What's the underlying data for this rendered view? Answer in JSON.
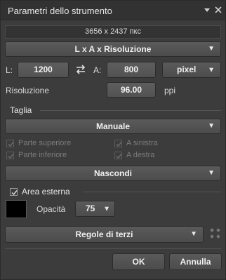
{
  "window": {
    "title": "Parametri dello strumento"
  },
  "size_display": "3656 x 2437 пкс",
  "mode_select": {
    "value": "L x A x Risoluzione"
  },
  "dimensions": {
    "width_label": "L:",
    "width_value": "1200",
    "height_label": "A:",
    "height_value": "800",
    "unit_value": "pixel"
  },
  "resolution": {
    "label": "Risoluzione",
    "value": "96.00",
    "unit": "ppi"
  },
  "crop": {
    "section_label": "Taglia",
    "mode_value": "Manuale",
    "checkboxes": [
      {
        "label": "Parte superiore",
        "checked": true,
        "enabled": false
      },
      {
        "label": "A sinistra",
        "checked": true,
        "enabled": false
      },
      {
        "label": "Parte inferiore",
        "checked": true,
        "enabled": false
      },
      {
        "label": "A destra",
        "checked": true,
        "enabled": false
      }
    ],
    "visibility_value": "Nascondi"
  },
  "outer_area": {
    "label": "Area esterna",
    "checked": true,
    "color": "#000000",
    "opacity_label": "Opacità",
    "opacity_value": "75"
  },
  "rules_select": {
    "value": "Regole di terzi"
  },
  "buttons": {
    "ok": "OK",
    "cancel": "Annulla"
  },
  "colors": {
    "panel_bg": "#3c3c3c",
    "control_bg": "#555555",
    "text": "#d8d8d8"
  }
}
